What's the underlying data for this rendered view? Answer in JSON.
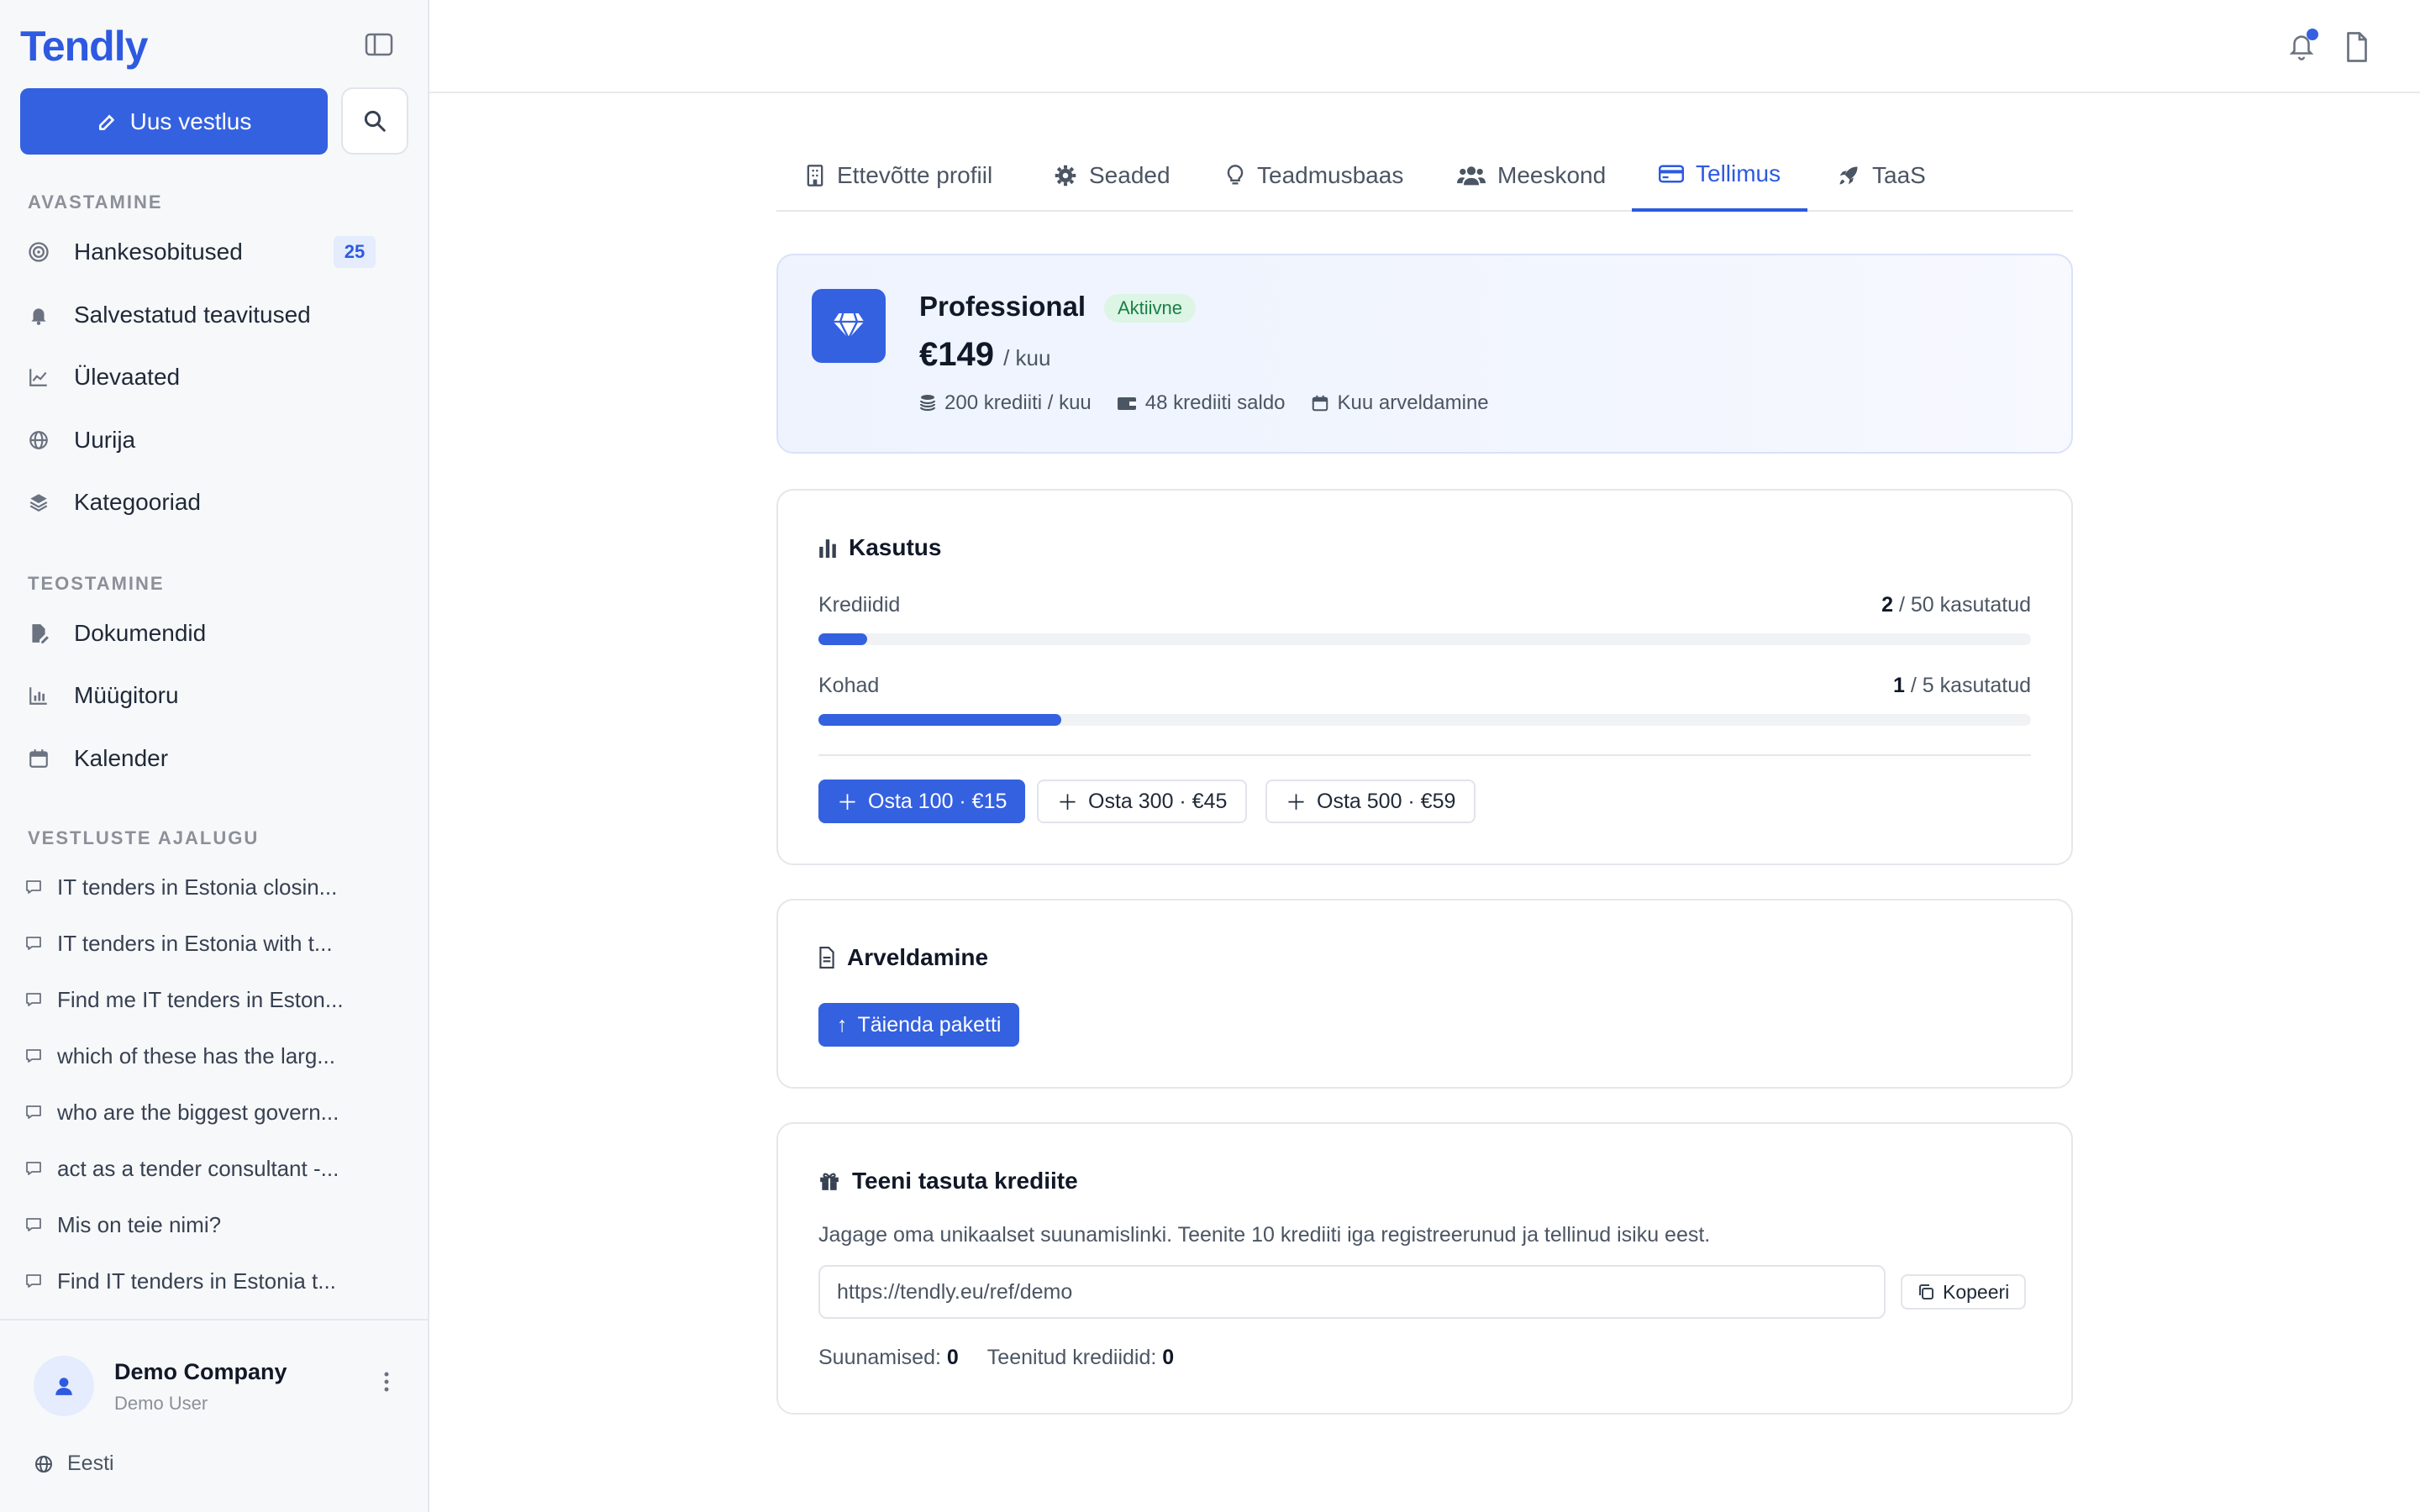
{
  "app": {
    "logo": "Tendly"
  },
  "sidebar": {
    "new_chat": "Uus vestlus",
    "sections": {
      "discover": "AVASTAMINE",
      "create": "TEOSTAMINE",
      "history": "VESTLUSTE AJALUGU"
    },
    "discover_items": [
      {
        "label": "Hankesobitused",
        "icon": "target-icon",
        "badge": "25"
      },
      {
        "label": "Salvestatud teavitused",
        "icon": "bell-icon"
      },
      {
        "label": "Ülevaated",
        "icon": "chart-line-icon"
      },
      {
        "label": "Uurija",
        "icon": "globe-icon"
      },
      {
        "label": "Kategooriad",
        "icon": "layers-icon"
      }
    ],
    "create_items": [
      {
        "label": "Dokumendid",
        "icon": "file-edit-icon"
      },
      {
        "label": "Müügitoru",
        "icon": "bar-chart-icon"
      },
      {
        "label": "Kalender",
        "icon": "calendar-icon"
      }
    ],
    "history": [
      "IT tenders in Estonia closin...",
      "IT tenders in Estonia with t...",
      "Find me IT tenders in Eston...",
      "which of these has the larg...",
      "who are the biggest govern...",
      "act as a tender consultant -...",
      "Mis on teie nimi?",
      "Find IT tenders in Estonia t..."
    ],
    "user": {
      "company": "Demo Company",
      "name": "Demo User"
    },
    "language": "Eesti"
  },
  "tabs": [
    {
      "label": "Ettevõtte profiil",
      "icon": "building-icon"
    },
    {
      "label": "Seaded",
      "icon": "gear-icon"
    },
    {
      "label": "Teadmusbaas",
      "icon": "lightbulb-icon"
    },
    {
      "label": "Meeskond",
      "icon": "users-icon"
    },
    {
      "label": "Tellimus",
      "icon": "credit-card-icon",
      "active": true
    },
    {
      "label": "TaaS",
      "icon": "rocket-icon"
    }
  ],
  "plan": {
    "name": "Professional",
    "status": "Aktiivne",
    "price": "€149",
    "price_unit": "/ kuu",
    "meta": [
      "200 krediiti / kuu",
      "48 krediiti saldo",
      "Kuu arveldamine"
    ]
  },
  "usage": {
    "title": "Kasutus",
    "rows": [
      {
        "label": "Krediidid",
        "used": "2",
        "total": "/ 50 kasutatud",
        "fraction": 0.04
      },
      {
        "label": "Kohad",
        "used": "1",
        "total": "/ 5 kasutatud",
        "fraction": 0.2
      }
    ],
    "buy_buttons": [
      "Osta 100 · €15",
      "Osta 300 · €45",
      "Osta 500 · €59"
    ]
  },
  "billing": {
    "title": "Arveldamine",
    "upgrade": "Täienda paketti"
  },
  "referral": {
    "title": "Teeni tasuta krediite",
    "description": "Jagage oma unikaalset suunamislinki. Teenite 10 krediiti iga registreerunud ja tellinud isiku eest.",
    "link": "https://tendly.eu/ref/demo",
    "copy": "Kopeeri",
    "referrals_label": "Suunamised:",
    "referrals_value": "0",
    "earned_label": "Teenitud krediidid:",
    "earned_value": "0"
  },
  "colors": {
    "accent": "#3461e0",
    "active_pill_bg": "#dcf5e5",
    "active_pill_text": "#1a7f44"
  }
}
